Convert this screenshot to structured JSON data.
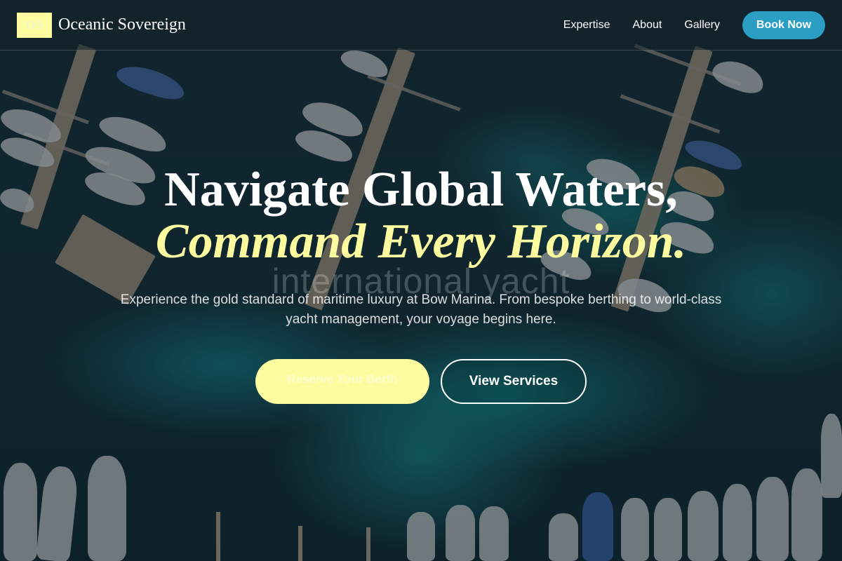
{
  "brand": {
    "logo_mark": "OS",
    "name": "Oceanic Sovereign"
  },
  "nav": {
    "items": [
      {
        "label": "Expertise"
      },
      {
        "label": "About"
      },
      {
        "label": "Gallery"
      }
    ],
    "cta_label": "Book Now"
  },
  "hero": {
    "headline_line1": "Navigate Global Waters,",
    "headline_line2": "Command Every Horizon.",
    "ghost_text": "international yacht",
    "subtitle": "Experience the gold standard of maritime luxury at Bow Marina. From bespoke berthing to world-class yacht management, your voyage begins here.",
    "primary_cta": "Reserve Your Berth",
    "secondary_cta": "View Services"
  },
  "colors": {
    "accent_yellow": "#fdfba0",
    "accent_blue": "#2a9fc3",
    "header_bg": "rgba(20,34,42,0.55)"
  }
}
